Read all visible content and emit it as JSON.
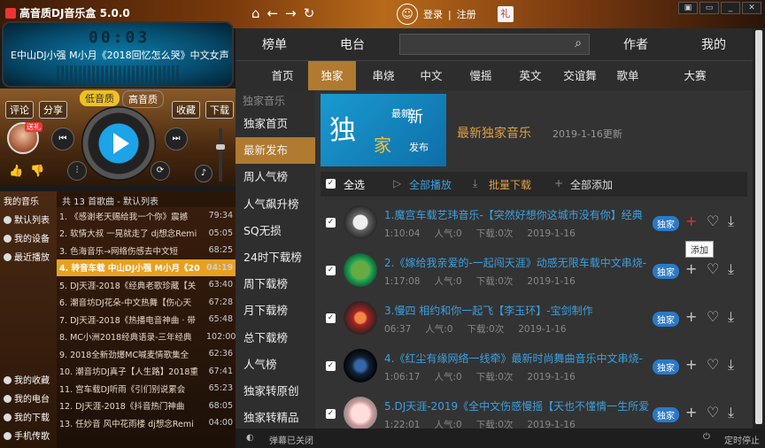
{
  "app": {
    "title": "高音质DJ音乐盒 5.0.0",
    "login": "登录",
    "register": "注册"
  },
  "player": {
    "time": "00:03",
    "now_playing": "E中山DJ小强 M小月《2018回忆怎么哭》中文女声",
    "quality_low": "低音质",
    "quality_high": "高音质",
    "comment": "评论",
    "share": "分享",
    "collect": "收藏",
    "download": "下载",
    "avatar_badge": "送礼"
  },
  "left_nav": [
    {
      "label": "我的音乐"
    },
    {
      "label": "默认列表"
    },
    {
      "label": "我的设备"
    },
    {
      "label": "最近播放"
    },
    {
      "label": "我的收藏"
    },
    {
      "label": "我的电台"
    },
    {
      "label": "我的下载"
    },
    {
      "label": "手机传歌"
    }
  ],
  "playlist": {
    "header": "共 13 首歌曲 - 默认列表",
    "rows": [
      {
        "title": "1. 《感谢老天赐给我一个你》震撼",
        "dur": "79:34"
      },
      {
        "title": "2. 软情大叔 一晃就走了 dj想念Remi",
        "dur": "05:05"
      },
      {
        "title": "3. 色海音乐→网络伤感去中文短",
        "dur": "68:25"
      },
      {
        "title": "4. 转音车载 中山DJ小强 M小月《20",
        "dur": "04:19",
        "cur": true
      },
      {
        "title": "5. DJ天涯-2018《经典老歌珍藏【关",
        "dur": "63:40"
      },
      {
        "title": "6. 潮音坊DJ花朵-中文热舞【伤心天",
        "dur": "67:28"
      },
      {
        "title": "7. DJ天涯-2018《热播电音神曲 · 带",
        "dur": "65:48"
      },
      {
        "title": "8. MC小洲2018经典语录-三年经典",
        "dur": "102:00"
      },
      {
        "title": "9. 2018全新劲爆MC喊麦情歌集全",
        "dur": "62:36"
      },
      {
        "title": "10. 潮音坊DJ真子【人生路】2018重",
        "dur": "67:41"
      },
      {
        "title": "11. 宫车载DJ听雨《引们别说累会",
        "dur": "65:23"
      },
      {
        "title": "12. DJ天涯-2018《抖音热门神曲",
        "dur": "68:05"
      },
      {
        "title": "13. 任妙音 风中花雨楼 dj想念Remi",
        "dur": "04:00"
      }
    ]
  },
  "header_tabs": [
    "榜单",
    "电台",
    "作者",
    "我的"
  ],
  "sub_tabs": [
    "首页",
    "独家",
    "串烧",
    "中文",
    "慢摇",
    "英文",
    "交谊舞",
    "歌单",
    "大赛"
  ],
  "categories": {
    "heading": "独家音乐",
    "items": [
      "独家首页",
      "最新发布",
      "周人气榜",
      "人气飙升榜",
      "SQ无损",
      "24时下载榜",
      "周下载榜",
      "月下载榜",
      "总下载榜",
      "人气榜",
      "独家转原创",
      "独家转精品"
    ]
  },
  "banner": {
    "big": "独",
    "mid": "最新",
    "small": "家",
    "new": "新",
    "publish": "发布",
    "title": "最新独家音乐",
    "date": "2019-1-16更新"
  },
  "actions": {
    "select_all": "全选",
    "play_all": "全部播放",
    "batch_download": "批量下载",
    "add_all": "全部添加"
  },
  "songs": [
    {
      "title": "1.魔宫车载艺玮音乐-【突然好想你这城市没有你】经典",
      "dur": "1:10:04",
      "pop": "人气:0",
      "dl": "下载:0次",
      "date": "2019-1-16",
      "badge": "独家"
    },
    {
      "title": "2.《嫁给我亲爱的-一起闯天涯》动感无限车载中文串烧-",
      "dur": "1:17:08",
      "pop": "人气:0",
      "dl": "下载:0次",
      "date": "2019-1-16",
      "badge": "独家"
    },
    {
      "title": "3.慢四 相约和你一起飞【李玉环】-宝剑制作",
      "dur": "06:37",
      "pop": "人气:0",
      "dl": "下载:0次",
      "date": "2019-1-16",
      "badge": "独家"
    },
    {
      "title": "4.《红尘有缘网络一线牵》最新时尚舞曲音乐中文串烧-",
      "dur": "1:06:17",
      "pop": "人气:0",
      "dl": "下载:0次",
      "date": "2019-1-16",
      "badge": "独家"
    },
    {
      "title": "5.DJ天涯-2019《全中文伤感慢摇【天也不懂情一生所爱",
      "dur": "1:22:01",
      "pop": "人气:0",
      "dl": "下载:0次",
      "date": "2019-1-16",
      "badge": "独家"
    }
  ],
  "tooltip": "添加",
  "bottom": {
    "popup": "弹幕已关闭",
    "timer": "定时停止"
  }
}
